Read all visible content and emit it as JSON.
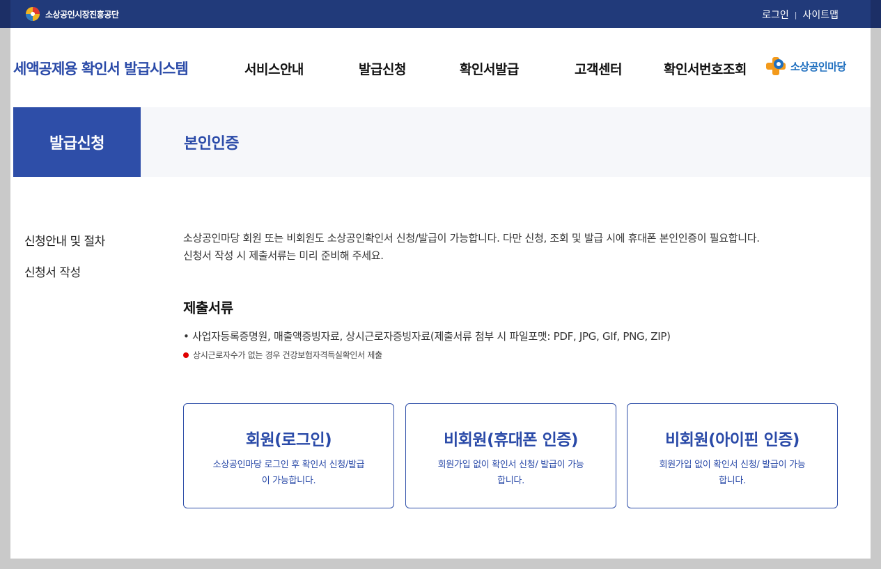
{
  "header": {
    "org_name": "소상공인시장진흥공단",
    "links": [
      {
        "label": "로그인"
      },
      {
        "label": "사이트맵"
      }
    ],
    "separator": "|"
  },
  "site": {
    "title": "세액공제용 확인서 발급시스템",
    "partner_logo_text": "소상공인마당"
  },
  "nav": {
    "items": [
      {
        "label": "서비스안내"
      },
      {
        "label": "발급신청"
      },
      {
        "label": "확인서발급"
      },
      {
        "label": "고객센터"
      },
      {
        "label": "확인서번호조회"
      }
    ]
  },
  "section": {
    "tab_label": "발급신청",
    "title": "본인인증"
  },
  "side_menu": {
    "items": [
      {
        "label": "신청안내 및 절차"
      },
      {
        "label": "신청서 작성"
      }
    ]
  },
  "main": {
    "intro_line1": "소상공인마당 회원 또는 비회원도 소상공인확인서 신청/발급이 가능합니다. 다만 신청, 조회 및 발급 시에 휴대폰 본인인증이 필요합니다.",
    "intro_line2": "신청서 작성 시 제출서류는 미리 준비해 주세요.",
    "docs_title": "제출서류",
    "docs_item": "• 사업자등록증명원, 매출액증빙자료, 상시근로자증빙자료(제출서류 첨부 시 파일포맷: PDF, JPG, GIf, PNG, ZIP)",
    "docs_note": "상시근로자수가 없는 경우 건강보험자격득실확인서 제출"
  },
  "cards": [
    {
      "title": "회원(로그인)",
      "desc": "소상공인마당 로그인 후 확인서 신청/발급이 가능합니다."
    },
    {
      "title": "비회원(휴대폰 인증)",
      "desc": "회원가입 없이 확인서 신청/ 발급이 가능합니다."
    },
    {
      "title": "비회원(아이핀 인증)",
      "desc": "회원가입 없이 확인서 신청/ 발급이 가능합니다."
    }
  ],
  "colors": {
    "top_bar": "#213a7a",
    "accent": "#2e4ea8",
    "note_dot": "#e00000",
    "partner_blue": "#1f6fbf",
    "partner_orange": "#f39a1b"
  },
  "icons": {
    "org_logo": "org-logo-icon",
    "partner_logo": "partner-logo-icon",
    "note_bullet": "red-dot-icon"
  }
}
